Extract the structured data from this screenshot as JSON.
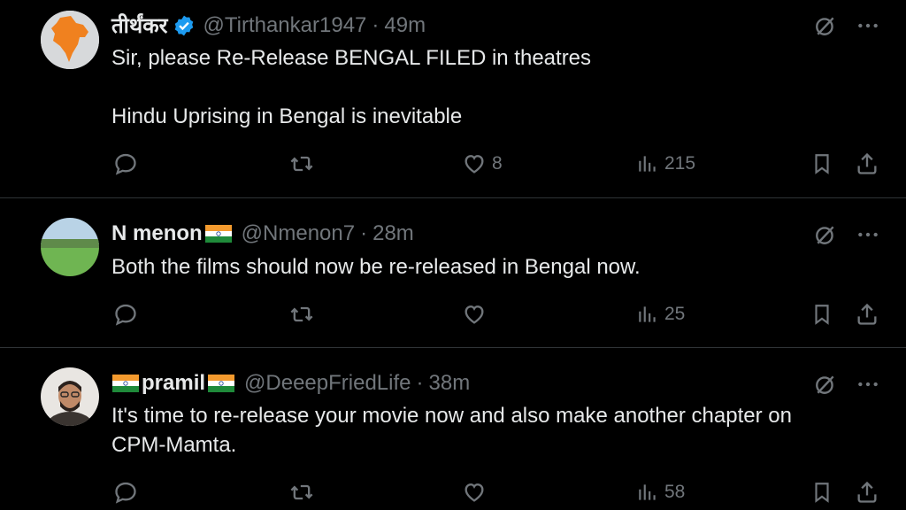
{
  "tweets": [
    {
      "name": "तीर्थंकर",
      "handle": "@Tirthankar1947",
      "time": "49m",
      "verified": true,
      "lines": [
        "Sir, please Re-Release BENGAL FILED in theatres",
        "",
        "Hindu Uprising in Bengal is inevitable"
      ],
      "likes": "8",
      "views": "215"
    },
    {
      "name": "N menon",
      "handle": "@Nmenon7",
      "time": "28m",
      "lines": [
        "Both the films should now be re-released in Bengal now."
      ],
      "likes": "",
      "views": "25"
    },
    {
      "name": "pramil",
      "handle": "@DeeepFriedLife",
      "time": "38m",
      "lines": [
        "It's time to re-release your movie now and also make another chapter on",
        "CPM-Mamta."
      ],
      "likes": "",
      "views": "58"
    }
  ],
  "separator": "·",
  "colors": {
    "background": "#000000",
    "text": "#e7e9ea",
    "muted": "#71767b",
    "verified": "#1d9bf0",
    "divider": "#2f3336"
  },
  "icons": [
    "grok-icon",
    "more-icon",
    "reply-icon",
    "retweet-icon",
    "like-icon",
    "views-icon",
    "bookmark-icon",
    "share-icon",
    "verified-badge-icon",
    "india-flag-icon"
  ]
}
